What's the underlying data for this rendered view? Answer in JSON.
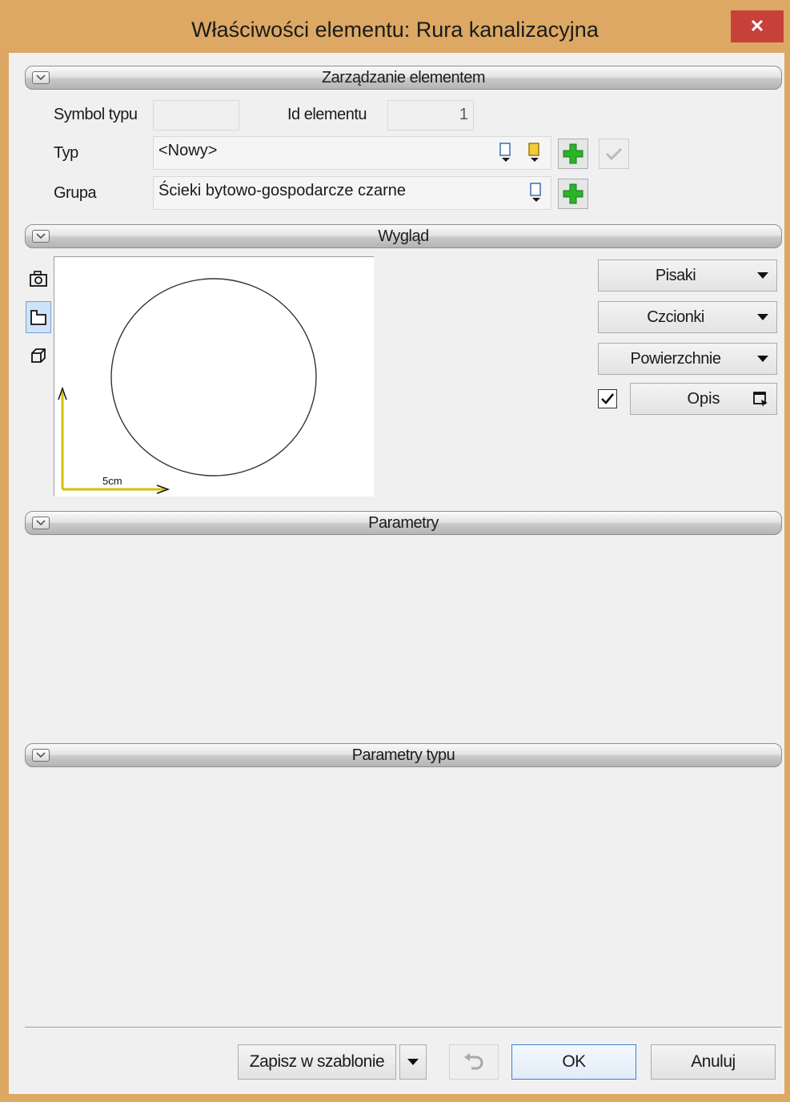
{
  "window": {
    "title": "Właściwości elementu: Rura kanalizacyjna",
    "close_glyph": "✕"
  },
  "sections": {
    "management": "Zarządzanie elementem",
    "appearance": "Wygląd",
    "parameters": "Parametry",
    "type_parameters": "Parametry typu"
  },
  "management": {
    "symbol_label": "Symbol typu",
    "symbol_value": "",
    "id_label": "Id elementu",
    "id_value": "1",
    "type_label": "Typ",
    "type_value": "<Nowy>",
    "group_label": "Grupa",
    "group_value": "Ścieki bytowo-gospodarcze czarne"
  },
  "appearance": {
    "scale_label": "5cm",
    "pens": "Pisaki",
    "fonts": "Czcionki",
    "surfaces": "Powierzchnie",
    "description": "Opis",
    "description_checked": true
  },
  "footer": {
    "save_template": "Zapisz w szablonie",
    "ok": "OK",
    "cancel": "Anuluj"
  },
  "colors": {
    "accent": "#3c7fd0",
    "frame": "#dca863",
    "close": "#c7403a",
    "axis": "#d4c000"
  }
}
